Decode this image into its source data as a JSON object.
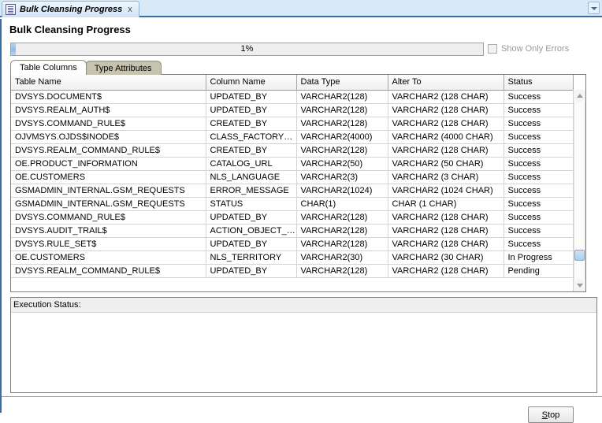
{
  "window": {
    "tab": {
      "title": "Bulk Cleansing Progress",
      "icon": "document-icon",
      "close_label": "x"
    },
    "tabstrip_menu_icon": "chevron-down-icon"
  },
  "page": {
    "title": "Bulk Cleansing Progress"
  },
  "progress": {
    "percent_label": "1%",
    "percent_value": 1,
    "fill_color": "#8fbbe4"
  },
  "show_only_errors": {
    "label": "Show Only Errors",
    "checked": false,
    "enabled": false
  },
  "inner_tabs": [
    {
      "label": "Table Columns",
      "selected": true
    },
    {
      "label": "Type Attributes",
      "selected": false
    }
  ],
  "table": {
    "columns": [
      "Table Name",
      "Column Name",
      "Data Type",
      "Alter To",
      "Status"
    ],
    "rows": [
      [
        "DVSYS.DOCUMENT$",
        "UPDATED_BY",
        "VARCHAR2(128)",
        "VARCHAR2 (128 CHAR)",
        "Success"
      ],
      [
        "DVSYS.REALM_AUTH$",
        "UPDATED_BY",
        "VARCHAR2(128)",
        "VARCHAR2 (128 CHAR)",
        "Success"
      ],
      [
        "DVSYS.COMMAND_RULE$",
        "CREATED_BY",
        "VARCHAR2(128)",
        "VARCHAR2 (128 CHAR)",
        "Success"
      ],
      [
        "OJVMSYS.OJDS$INODE$",
        "CLASS_FACTORY_LO...",
        "VARCHAR2(4000)",
        "VARCHAR2 (4000 CHAR)",
        "Success"
      ],
      [
        "DVSYS.REALM_COMMAND_RULE$",
        "CREATED_BY",
        "VARCHAR2(128)",
        "VARCHAR2 (128 CHAR)",
        "Success"
      ],
      [
        "OE.PRODUCT_INFORMATION",
        "CATALOG_URL",
        "VARCHAR2(50)",
        "VARCHAR2 (50 CHAR)",
        "Success"
      ],
      [
        "OE.CUSTOMERS",
        "NLS_LANGUAGE",
        "VARCHAR2(3)",
        "VARCHAR2 (3 CHAR)",
        "Success"
      ],
      [
        "GSMADMIN_INTERNAL.GSM_REQUESTS",
        "ERROR_MESSAGE",
        "VARCHAR2(1024)",
        "VARCHAR2 (1024 CHAR)",
        "Success"
      ],
      [
        "GSMADMIN_INTERNAL.GSM_REQUESTS",
        "STATUS",
        "CHAR(1)",
        "CHAR (1 CHAR)",
        "Success"
      ],
      [
        "DVSYS.COMMAND_RULE$",
        "UPDATED_BY",
        "VARCHAR2(128)",
        "VARCHAR2 (128 CHAR)",
        "Success"
      ],
      [
        "DVSYS.AUDIT_TRAIL$",
        "ACTION_OBJECT_NA...",
        "VARCHAR2(128)",
        "VARCHAR2 (128 CHAR)",
        "Success"
      ],
      [
        "DVSYS.RULE_SET$",
        "UPDATED_BY",
        "VARCHAR2(128)",
        "VARCHAR2 (128 CHAR)",
        "Success"
      ],
      [
        "OE.CUSTOMERS",
        "NLS_TERRITORY",
        "VARCHAR2(30)",
        "VARCHAR2 (30 CHAR)",
        "In Progress"
      ],
      [
        "DVSYS.REALM_COMMAND_RULE$",
        "UPDATED_BY",
        "VARCHAR2(128)",
        "VARCHAR2 (128 CHAR)",
        "Pending"
      ]
    ]
  },
  "scrollbar": {
    "up_icon": "scroll-up-arrow-icon",
    "down_icon": "scroll-down-arrow-icon"
  },
  "execution_status": {
    "label": "Execution Status:",
    "content": ""
  },
  "footer": {
    "stop_button": {
      "label": "Stop",
      "mnemonic": "S",
      "rest": "top"
    }
  }
}
